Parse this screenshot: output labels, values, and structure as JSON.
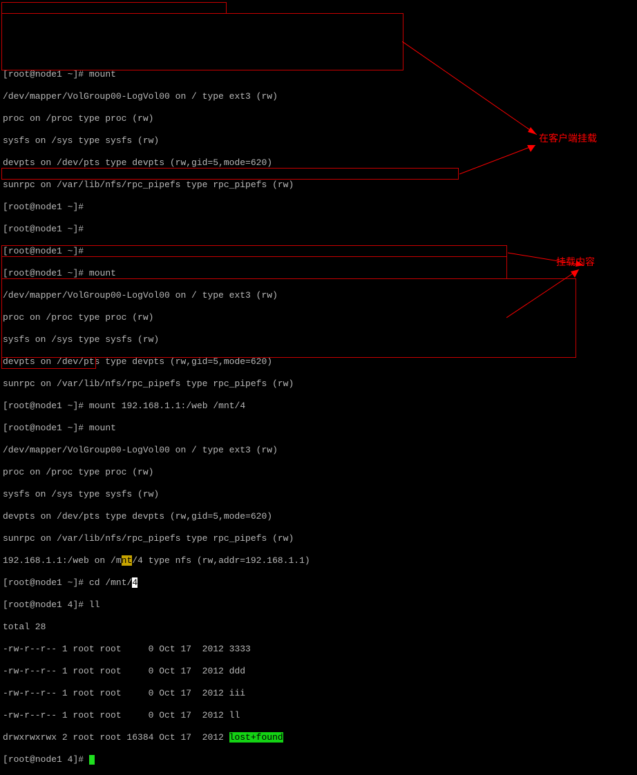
{
  "prompt": {
    "user": "root",
    "host": "node1",
    "home_dir": "~",
    "four_dir": "4",
    "hash": "#"
  },
  "cmds": {
    "mount": "mount",
    "mount_nfs": "mount 192.168.1.1:/web /mnt/4",
    "cd_mnt4_prefix": "cd /mnt/",
    "cd_mnt4_char": "4",
    "ll": "ll"
  },
  "mount_output": {
    "l1": "/dev/mapper/VolGroup00-LogVol00 on / type ext3 (rw)",
    "l2": "proc on /proc type proc (rw)",
    "l3": "sysfs on /sys type sysfs (rw)",
    "l4": "devpts on /dev/pts type devpts (rw,gid=5,mode=620)",
    "l5": "sunrpc on /var/lib/nfs/rpc_pipefs type rpc_pipefs (rw)",
    "nfs_pre": "192.168.1.1:/web on /m",
    "nfs_hl": "nt",
    "nfs_post": "/4 type nfs (rw,addr=192.168.1.1)"
  },
  "ll_output": {
    "total": "total 28",
    "r1": "-rw-r--r-- 1 root root     0 Oct 17  2012 3333",
    "r2": "-rw-r--r-- 1 root root     0 Oct 17  2012 ddd",
    "r3": "-rw-r--r-- 1 root root     0 Oct 17  2012 iii",
    "r4": "-rw-r--r-- 1 root root     0 Oct 17  2012 ll",
    "r5_pre": "drwxrwxrwx 2 root root 16384 Oct 17  2012 ",
    "r5_dir": "lost+found"
  },
  "annotations": {
    "client_mount": "在客户端挂载",
    "mount_content": "挂载内容"
  }
}
